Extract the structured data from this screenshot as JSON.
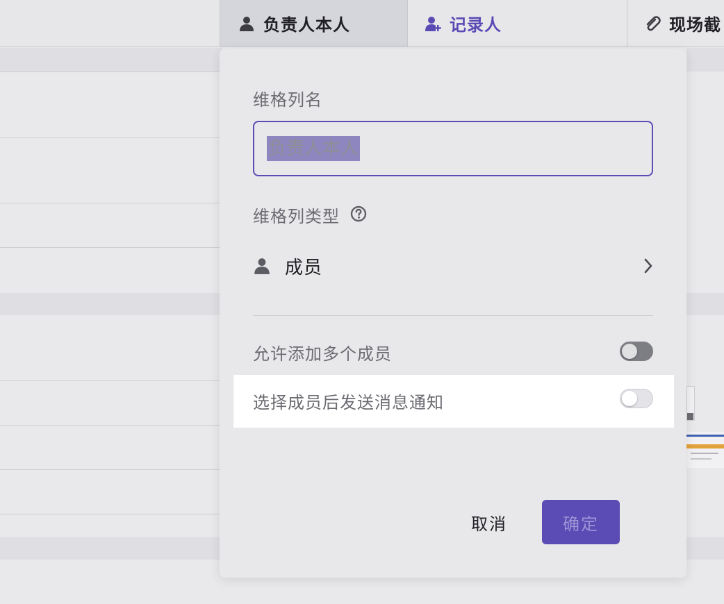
{
  "header": {
    "columns": [
      {
        "label": "负责人本人",
        "icon": "person-icon"
      },
      {
        "label": "记录人",
        "icon": "person-add-icon"
      },
      {
        "label": "现场截",
        "icon": "paperclip-icon"
      }
    ]
  },
  "popup": {
    "name_label": "维格列名",
    "name_value": "负责人本人",
    "type_label": "维格列类型",
    "type_value": "成员",
    "allow_multiple_label": "允许添加多个成员",
    "notify_label": "选择成员后发送消息通知",
    "cancel_label": "取消",
    "confirm_label": "确定"
  },
  "colors": {
    "accent": "#5b4bb5",
    "highlight": "#ffffff"
  }
}
